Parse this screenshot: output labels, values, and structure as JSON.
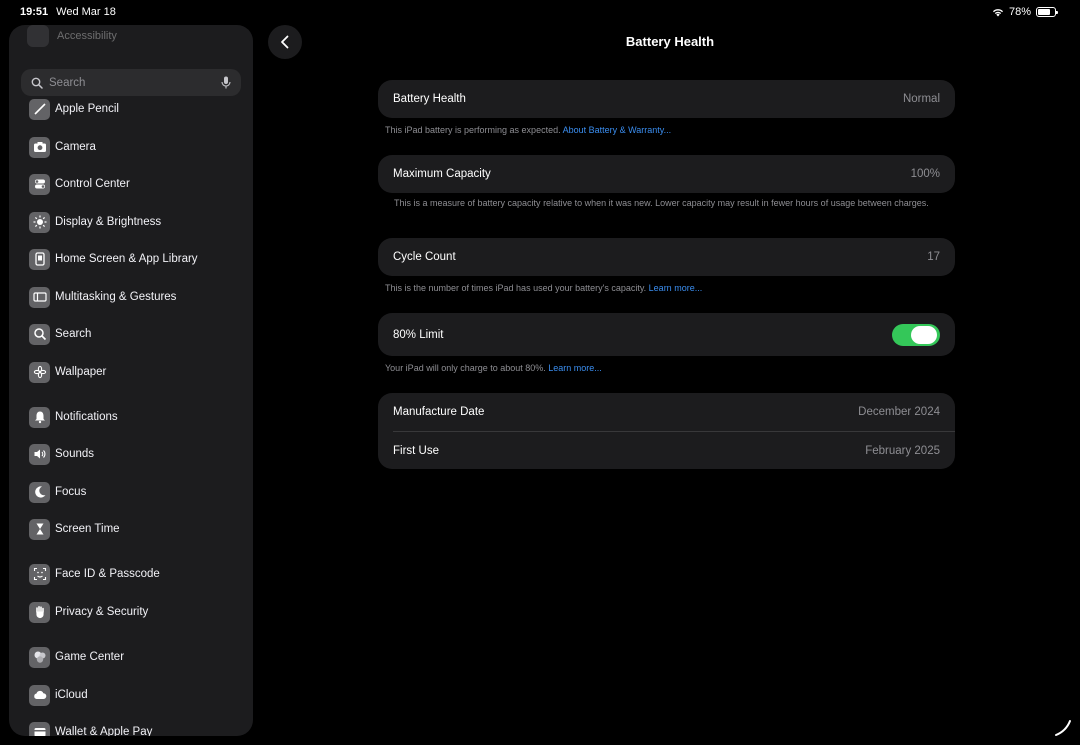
{
  "status": {
    "time": "19:51",
    "date": "Wed Mar 18",
    "battery": "78%",
    "battery_level": 0.78
  },
  "sidebar": {
    "faded_item": "Accessibility",
    "search_placeholder": "Search",
    "items": [
      {
        "label": "Apple Pencil",
        "icon": "pencil-icon"
      },
      {
        "label": "Camera",
        "icon": "camera-icon"
      },
      {
        "label": "Control Center",
        "icon": "switches-icon"
      },
      {
        "label": "Display & Brightness",
        "icon": "sun-icon"
      },
      {
        "label": "Home Screen & App Library",
        "icon": "phone-icon"
      },
      {
        "label": "Multitasking & Gestures",
        "icon": "multitask-icon"
      },
      {
        "label": "Search",
        "icon": "search-icon"
      },
      {
        "label": "Wallpaper",
        "icon": "flower-icon"
      },
      {
        "label": "Notifications",
        "icon": "bell-icon"
      },
      {
        "label": "Sounds",
        "icon": "speaker-icon"
      },
      {
        "label": "Focus",
        "icon": "moon-icon"
      },
      {
        "label": "Screen Time",
        "icon": "hourglass-icon"
      },
      {
        "label": "Face ID & Passcode",
        "icon": "faceid-icon"
      },
      {
        "label": "Privacy & Security",
        "icon": "hand-icon"
      },
      {
        "label": "Game Center",
        "icon": "gamecenter-icon"
      },
      {
        "label": "iCloud",
        "icon": "cloud-icon"
      },
      {
        "label": "Wallet & Apple Pay",
        "icon": "wallet-icon"
      }
    ]
  },
  "page": {
    "title": "Battery Health"
  },
  "battery_health": {
    "label": "Battery Health",
    "value": "Normal",
    "footer_text": "This iPad battery is performing as expected. ",
    "footer_link": "About Battery & Warranty..."
  },
  "max_capacity": {
    "label": "Maximum Capacity",
    "value": "100%",
    "footer_text": "This is a measure of battery capacity relative to when it was new. Lower capacity may result in fewer hours of usage between charges."
  },
  "cycle_count": {
    "label": "Cycle Count",
    "value": "17",
    "footer_text": "This is the number of times iPad has used your battery's capacity. ",
    "footer_link": "Learn more..."
  },
  "limit": {
    "label": "80% Limit",
    "enabled": true,
    "footer_text": "Your iPad will only charge to about 80%. ",
    "footer_link": "Learn more..."
  },
  "dates": {
    "manufacture_label": "Manufacture Date",
    "manufacture_value": "December 2024",
    "first_use_label": "First Use",
    "first_use_value": "February 2025"
  }
}
